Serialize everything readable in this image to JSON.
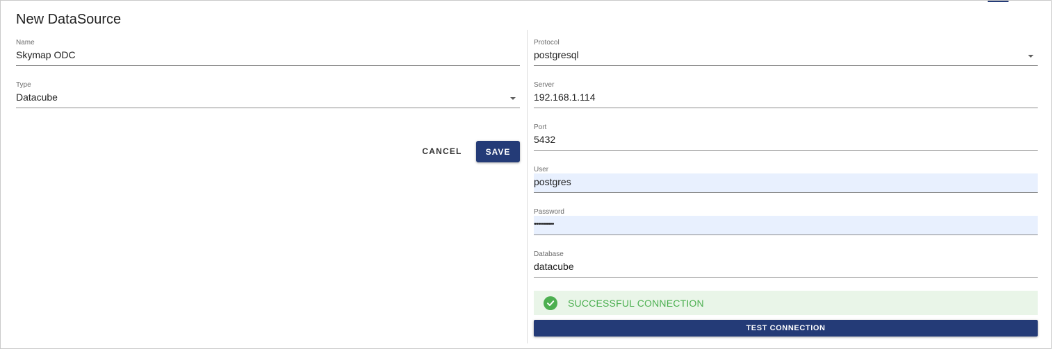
{
  "dialog": {
    "title": "New DataSource"
  },
  "left": {
    "name": {
      "label": "Name",
      "value": "Skymap ODC"
    },
    "type": {
      "label": "Type",
      "value": "Datacube"
    },
    "cancel_label": "CANCEL",
    "save_label": "SAVE"
  },
  "right": {
    "protocol": {
      "label": "Protocol",
      "value": "postgresql"
    },
    "server": {
      "label": "Server",
      "value": "192.168.1.114"
    },
    "port": {
      "label": "Port",
      "value": "5432"
    },
    "user": {
      "label": "User",
      "value": "postgres"
    },
    "password": {
      "label": "Password",
      "value": "••••••••••"
    },
    "database": {
      "label": "Database",
      "value": "datacube"
    },
    "status_message": "SUCCESSFUL CONNECTION",
    "test_label": "TEST CONNECTION"
  },
  "colors": {
    "primary": "#243b77",
    "success": "#4caf50",
    "success_bg": "#e9f5e8",
    "autofill_bg": "#e8f0fe"
  },
  "icons": {
    "status": "check-circle-icon",
    "dropdown": "chevron-down-icon"
  }
}
